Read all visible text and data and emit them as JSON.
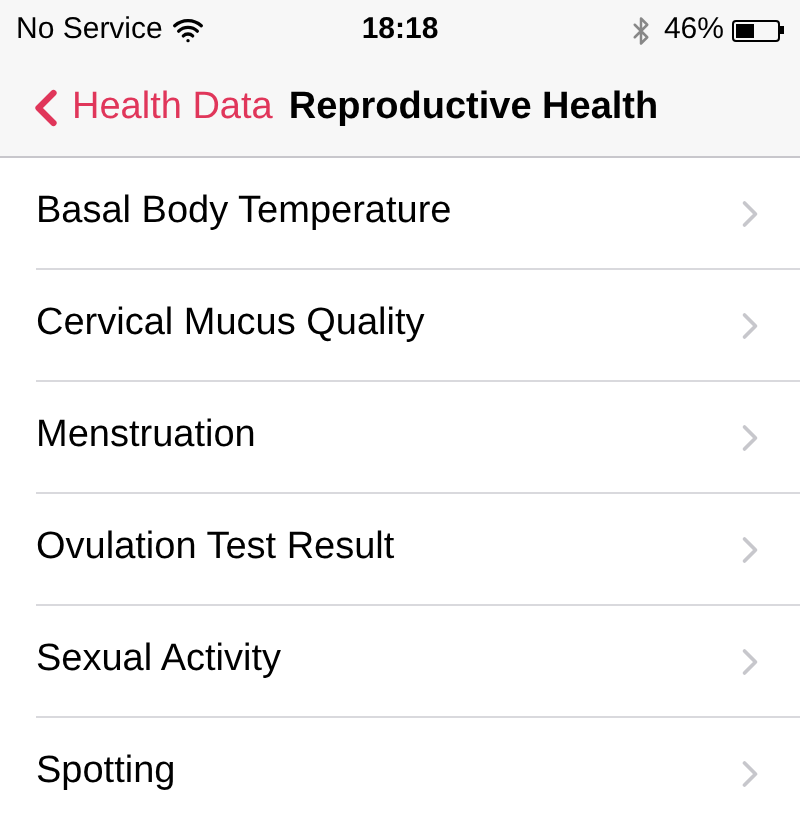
{
  "status_bar": {
    "carrier": "No Service",
    "time": "18:18",
    "battery": "46%"
  },
  "nav_bar": {
    "back": "Health Data",
    "title": "Reproductive Health"
  },
  "items": [
    {
      "label": "Basal Body Temperature"
    },
    {
      "label": "Cervical Mucus Quality"
    },
    {
      "label": "Menstruation"
    },
    {
      "label": "Ovulation Test Result"
    },
    {
      "label": "Sexual Activity"
    },
    {
      "label": "Spotting"
    }
  ]
}
